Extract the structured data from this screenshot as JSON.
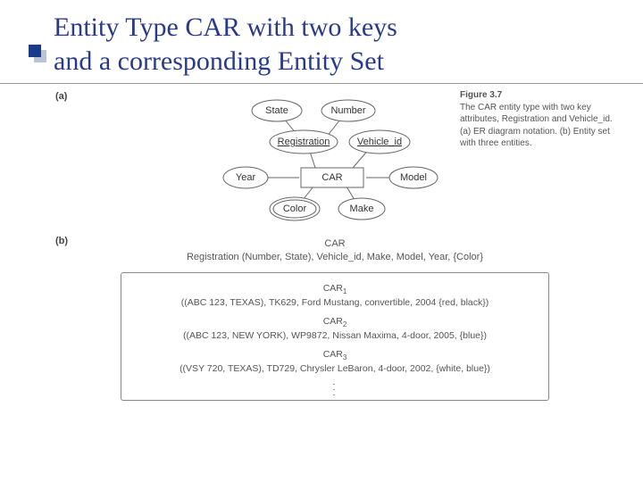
{
  "title_line1": "Entity Type CAR with two keys",
  "title_line2": "and a corresponding Entity Set",
  "label_a": "(a)",
  "label_b": "(b)",
  "figure": {
    "num": "Figure 3.7",
    "text": "The CAR entity type with two key attributes, Registration and Vehicle_id. (a) ER diagram notation. (b) Entity set with three entities."
  },
  "er": {
    "state": "State",
    "number": "Number",
    "registration": "Registration",
    "vehicle_id": "Vehicle_id",
    "year": "Year",
    "car": "CAR",
    "model": "Model",
    "color": "Color",
    "make": "Make"
  },
  "schema": {
    "name": "CAR",
    "line": "Registration (Number, State), Vehicle_id, Make, Model, Year, {Color}"
  },
  "entities": {
    "c1name": "CAR",
    "c1sub": "1",
    "c1": "((ABC 123, TEXAS), TK629, Ford Mustang, convertible, 2004 {red, black})",
    "c2name": "CAR",
    "c2sub": "2",
    "c2": "((ABC 123, NEW YORK), WP9872, Nissan Maxima, 4-door, 2005, {blue})",
    "c3name": "CAR",
    "c3sub": "3",
    "c3": "((VSY 720, TEXAS), TD729, Chrysler LeBaron, 4-door, 2002, {white, blue})",
    "dots1": ".",
    "dots2": ".",
    "dots3": "."
  }
}
